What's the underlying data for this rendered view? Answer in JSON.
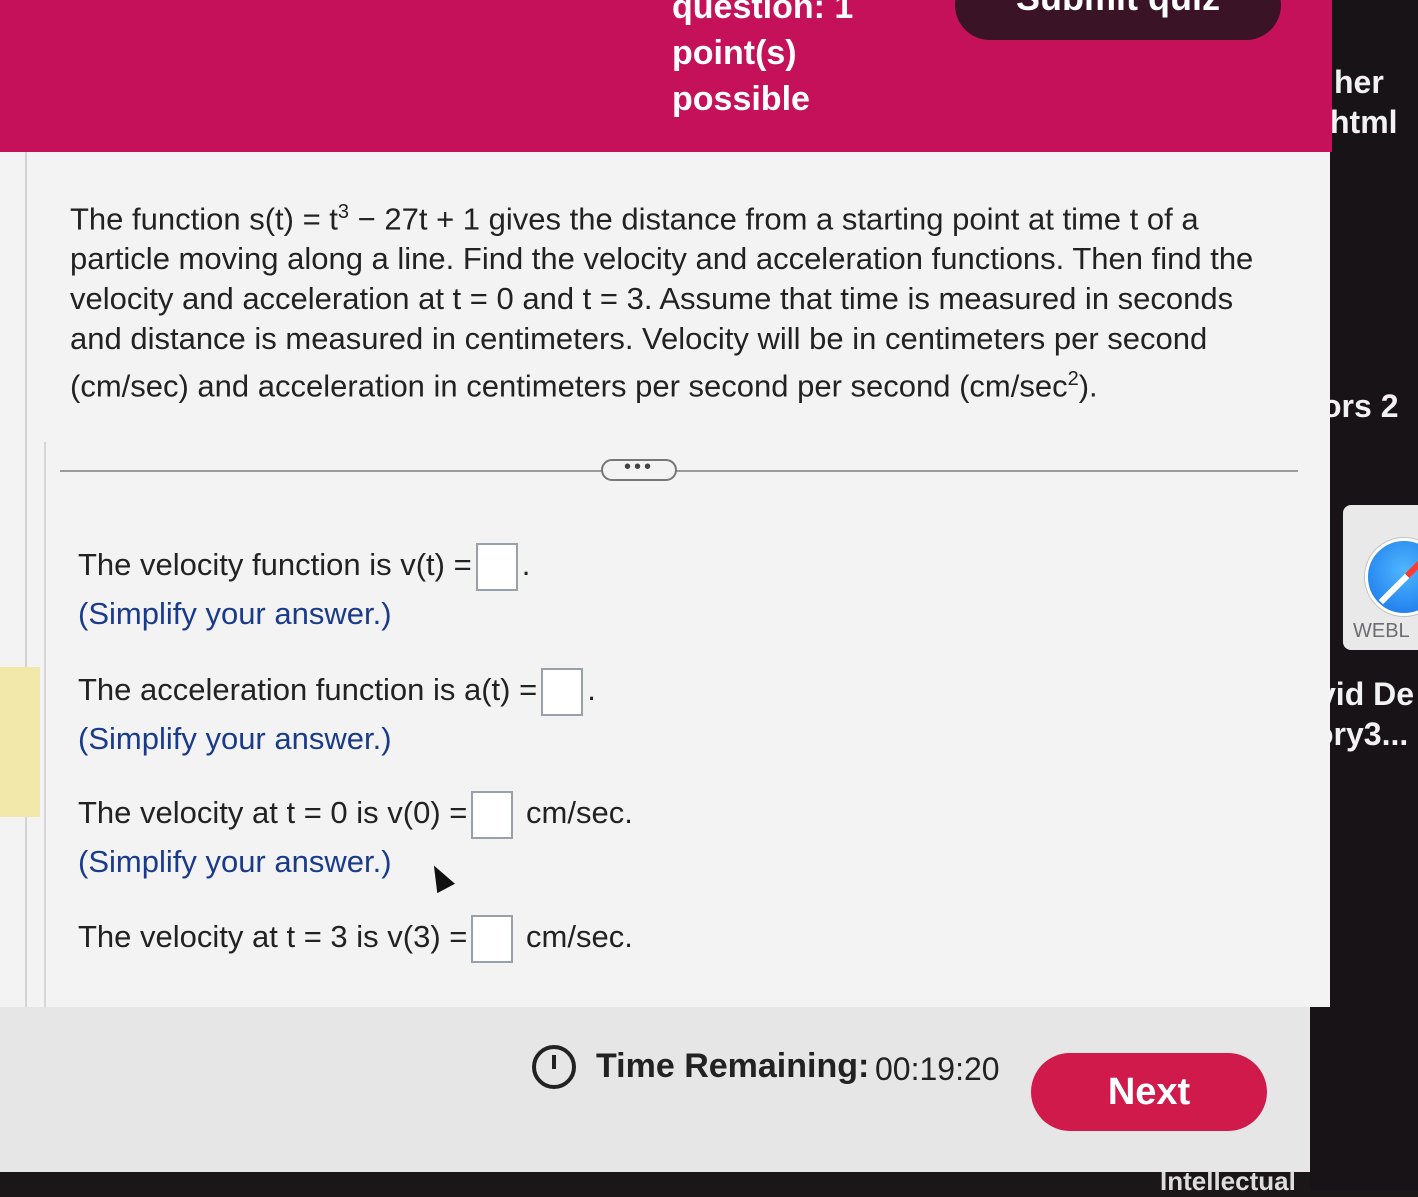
{
  "header": {
    "question_line1": "question: 1",
    "question_line2": "point(s)",
    "question_line3": "possible",
    "submit_label": "Submit quiz"
  },
  "desktop": {
    "text_1": "her",
    "text_2": "html",
    "text_3": "ors 2",
    "text_4": "vid De",
    "text_5": "ory3...",
    "safari_label": "WEBL",
    "bottom_text": "Intellectual"
  },
  "question": {
    "part1": "The function s(t) = t",
    "exp1": "3",
    "part2": " − 27t + 1 gives the distance from a starting point at time t of a particle moving along a line. Find the velocity and acceleration functions. Then find the velocity and acceleration at t = 0 and t = 3. Assume that time is measured in seconds and distance is measured in centimeters. Velocity will be in centimeters per second (cm/sec) and acceleration in centimeters per second per second (cm/sec",
    "exp2": "2",
    "part3": ")."
  },
  "divider_dots": "•••",
  "answers": {
    "velocity_fn": "The velocity function is v(t) =",
    "accel_fn": "The acceleration function is a(t) =",
    "v0": "The velocity at t = 0 is v(0) =",
    "v3": "The velocity at t = 3 is v(3) =",
    "unit": "cm/sec.",
    "period": ".",
    "hint": "(Simplify your answer.)"
  },
  "footer": {
    "time_label": "Time Remaining:",
    "time_value": "00:19:20",
    "next_label": "Next"
  }
}
